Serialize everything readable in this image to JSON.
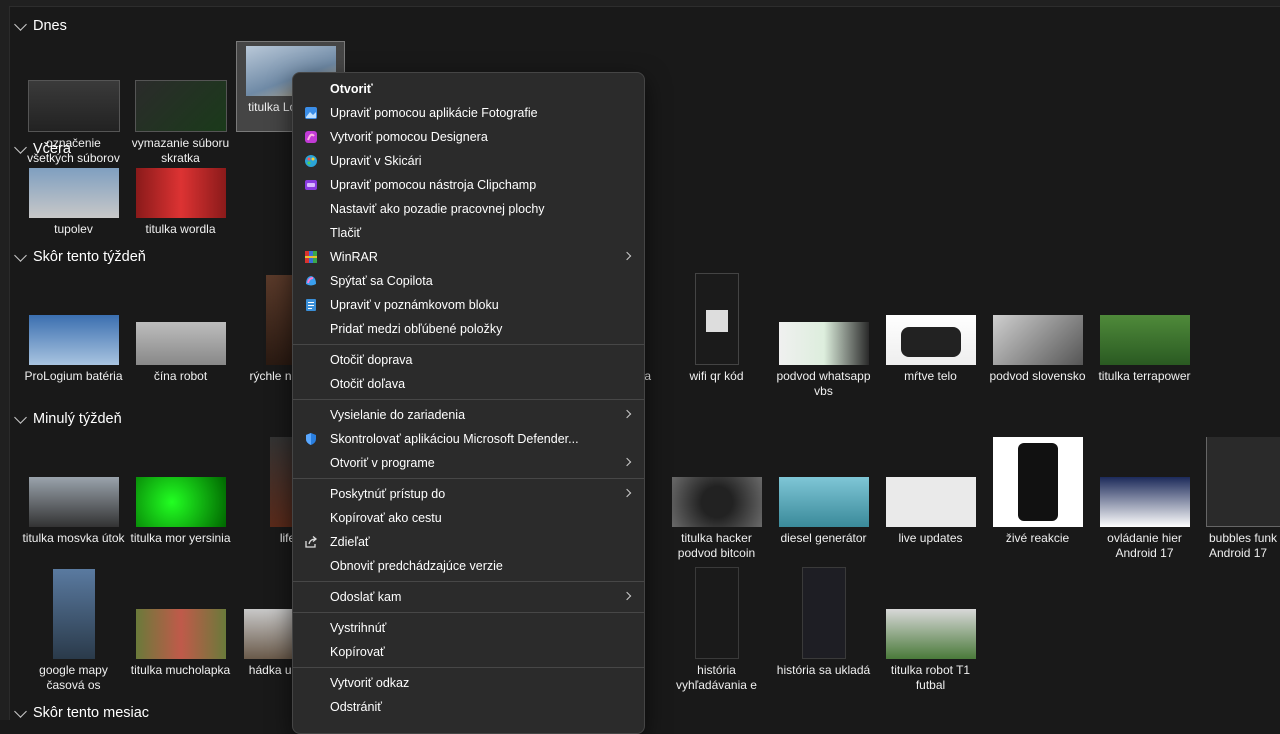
{
  "groups": [
    {
      "label": "Dnes"
    },
    {
      "label": "Včera"
    },
    {
      "label": "Skôr tento týždeň"
    },
    {
      "label": "Minulý týždeň"
    },
    {
      "label": "Skôr tento mesiac"
    }
  ],
  "tiles": {
    "today": [
      "označenie všetkých súborov",
      "vymazanie súboru skratka",
      "titulka Lo martin"
    ],
    "yesterday": [
      "tupolev",
      "titulka wordla"
    ],
    "earlier_week": [
      "ProLogium batéria",
      "čína robot",
      "rýchle na upra",
      "ta",
      "wifi qr kód",
      "podvod whatsapp vbs",
      "mŕtve telo",
      "podvod slovensko",
      "titulka terrapower"
    ],
    "last_week_row1": [
      "titulka mosvka útok",
      "titulka mor yersinia",
      "life",
      "titulka hacker podvod bitcoin",
      "diesel generátor",
      "live updates",
      "živé reakcie",
      "ovládanie hier Android 17",
      "bubbles funk Android 17"
    ],
    "last_week_row2": [
      "google mapy časová os",
      "titulka mucholapka",
      "hádka u intelig",
      "história vyhľadávania e",
      "história sa ukladá",
      "titulka robot T1 futbal"
    ]
  },
  "menu": {
    "open": "Otvoriť",
    "edit_photos": "Upraviť pomocou aplikácie Fotografie",
    "designer": "Vytvoriť pomocou Designera",
    "paint": "Upraviť v Skicári",
    "clipchamp": "Upraviť pomocou nástroja Clipchamp",
    "wallpaper": "Nastaviť ako pozadie pracovnej plochy",
    "print": "Tlačiť",
    "winrar": "WinRAR",
    "copilot": "Spýtať sa Copilota",
    "notepad": "Upraviť v poznámkovom bloku",
    "favorites": "Pridať medzi obľúbené položky",
    "rotate_right": "Otočiť doprava",
    "rotate_left": "Otočiť doľava",
    "cast": "Vysielanie do zariadenia",
    "defender": "Skontrolovať aplikáciou Microsoft Defender...",
    "open_with": "Otvoriť v programe",
    "give_access": "Poskytnúť prístup do",
    "copy_path": "Kopírovať ako cestu",
    "share": "Zdieľať",
    "restore": "Obnoviť predchádzajúce verzie",
    "send_to": "Odoslať kam",
    "cut": "Vystrihnúť",
    "copy": "Kopírovať",
    "shortcut": "Vytvoriť odkaz",
    "delete": "Odstrániť"
  },
  "colors": {
    "background": "#191919",
    "menu_bg": "#2b2b2b",
    "selection": "#454545"
  }
}
